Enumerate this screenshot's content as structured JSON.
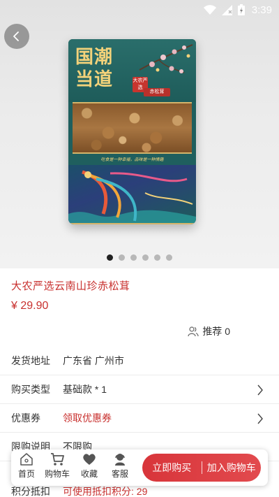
{
  "status_bar": {
    "time": "3:39"
  },
  "gallery": {
    "total_images": 6,
    "active_index": 0,
    "package": {
      "title_line1": "国潮",
      "title_line2": "当道",
      "badge": "大农严选",
      "tag": "赤松茸",
      "slogan": "吃食是一种幸福，品味是一种情趣"
    }
  },
  "product": {
    "title": "大农严选云南山珍赤松茸",
    "price": "¥ 29.90",
    "recommend": "推荐 0"
  },
  "details": [
    {
      "label": "发货地址",
      "value": "广东省 广州市",
      "chevron": false,
      "highlight": false
    },
    {
      "label": "购买类型",
      "value": "基础款 * 1",
      "chevron": true,
      "highlight": false
    },
    {
      "label": "优惠券",
      "value": "领取优惠券",
      "chevron": true,
      "highlight": true
    },
    {
      "label": "限购说明",
      "value": "不限购",
      "chevron": false,
      "highlight": false
    }
  ],
  "points": {
    "label": "积分抵扣",
    "value": "可使用抵扣积分: 29"
  },
  "bottom_bar": {
    "home": "首页",
    "cart": "购物车",
    "favorite": "收藏",
    "service": "客服",
    "buy_now": "立即购买",
    "add_to_cart": "加入购物车"
  },
  "colors": {
    "accent": "#c8302e",
    "cta": "#d8353a"
  }
}
